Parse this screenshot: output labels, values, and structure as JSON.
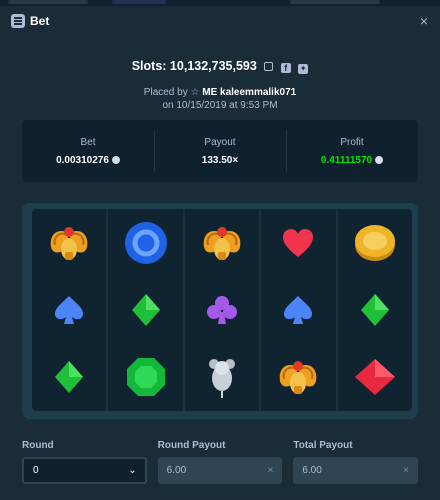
{
  "window": {
    "title": "Bet",
    "close": "×"
  },
  "bet": {
    "game_label": "Slots: 10,132,735,593",
    "placed_prefix": "Placed by",
    "user_badge": "ME",
    "username": "kaleemmalik071",
    "date_line": "on 10/15/2019 at 9:53 PM"
  },
  "stats": {
    "bet_label": "Bet",
    "bet_value": "0.00310276",
    "payout_label": "Payout",
    "payout_value": "133.50×",
    "profit_label": "Profit",
    "profit_value": "0.41111570"
  },
  "reels": [
    [
      "scarab",
      "spade",
      "diamond"
    ],
    [
      "blue-ring",
      "diamond",
      "emerald"
    ],
    [
      "scarab",
      "club",
      "mouse"
    ],
    [
      "heart",
      "spade",
      "scarab"
    ],
    [
      "coin",
      "diamond",
      "red-gem"
    ]
  ],
  "footer": {
    "round_label": "Round",
    "round_value": "0",
    "round_payout_label": "Round Payout",
    "round_payout_value": "6.00",
    "total_payout_label": "Total Payout",
    "total_payout_value": "6.00"
  },
  "colors": {
    "background": "#1a2c38",
    "panel": "#0f212e",
    "profit": "#00e701"
  }
}
